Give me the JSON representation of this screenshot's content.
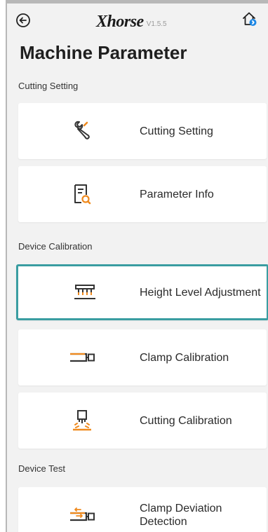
{
  "header": {
    "logo_text": "Xhorse",
    "version": "V1.5.5"
  },
  "page": {
    "title": "Machine Parameter"
  },
  "sections": [
    {
      "label": "Cutting Setting",
      "items": [
        {
          "label": "Cutting Setting",
          "icon": "wrench-icon"
        },
        {
          "label": "Parameter Info",
          "icon": "document-search-icon"
        }
      ]
    },
    {
      "label": "Device Calibration",
      "items": [
        {
          "label": "Height Level Adjustment",
          "icon": "height-level-icon",
          "selected": true
        },
        {
          "label": "Clamp Calibration",
          "icon": "clamp-icon"
        },
        {
          "label": "Cutting Calibration",
          "icon": "cutter-calibration-icon"
        }
      ]
    },
    {
      "label": "Device Test",
      "items": [
        {
          "label": "Clamp Deviation Detection",
          "icon": "clamp-deviation-icon"
        }
      ]
    }
  ],
  "colors": {
    "accent": "#3a9da1",
    "icon_orange": "#f08a1e",
    "icon_dark": "#333333",
    "home_badge": "#1e88e5"
  }
}
